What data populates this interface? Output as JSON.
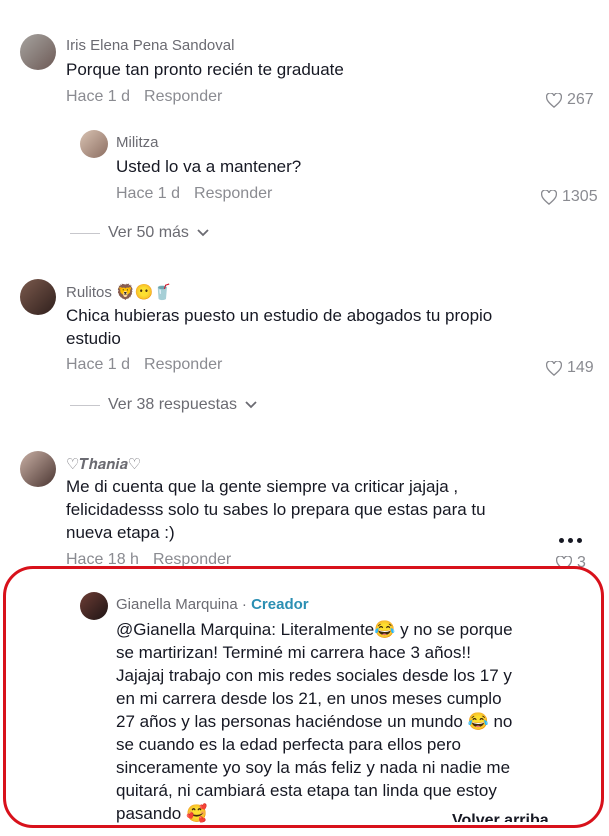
{
  "comments": [
    {
      "username": "Iris Elena Pena Sandoval",
      "text": "Porque tan pronto recién te graduate",
      "time": "Hace 1 d",
      "reply_label": "Responder",
      "likes": "267"
    },
    {
      "username": "Militza",
      "text": "Usted lo va a mantener?",
      "time": "Hace 1 d",
      "reply_label": "Responder",
      "likes": "1305"
    },
    {
      "username": "Rulitos 🦁😶🥤",
      "text_line1": "Chica hubieras puesto un estudio de abogados tu propio",
      "text_line2": "estudio",
      "time": "Hace 1 d",
      "reply_label": "Responder",
      "likes": "149"
    },
    {
      "username": "♡𝑻𝒉𝒂𝒏𝒊𝒂♡",
      "text_line1": "Me di cuenta que la gente siempre va criticar jajaja ,",
      "text_line2": "felicidadesss solo tu sabes lo prepara que estas para tu",
      "text_line3": "nueva etapa :)",
      "time": "Hace 18 h",
      "reply_label": "Responder",
      "likes": "3"
    },
    {
      "username": "Gianella Marquina",
      "separator": " · ",
      "creator_badge": "Creador",
      "lines": [
        "@Gianella Marquina: Literalmente😂 y no se porque",
        "se martirizan! Terminé mi carrera hace 3 años!!",
        "Jajajaj trabajo con mis redes sociales desde los 17 y",
        "en mi carrera desde los 21, en unos meses cumplo",
        "27 años y las personas haciéndose un mundo 😂 no",
        "se cuando es la edad perfecta para ellos pero",
        "sinceramente yo soy la más feliz y nada ni nadie me",
        "quitará, ni cambiará esta etapa tan linda que estoy",
        "pasando 🥰"
      ]
    }
  ],
  "view_more_1": "Ver 50 más",
  "view_more_2": "Ver 38 respuestas",
  "back_to_top": "Volver arriba",
  "colors": {
    "highlight_border": "#d8111b",
    "creator_accent": "#2b8fb3",
    "meta_gray": "#8a8b91"
  }
}
